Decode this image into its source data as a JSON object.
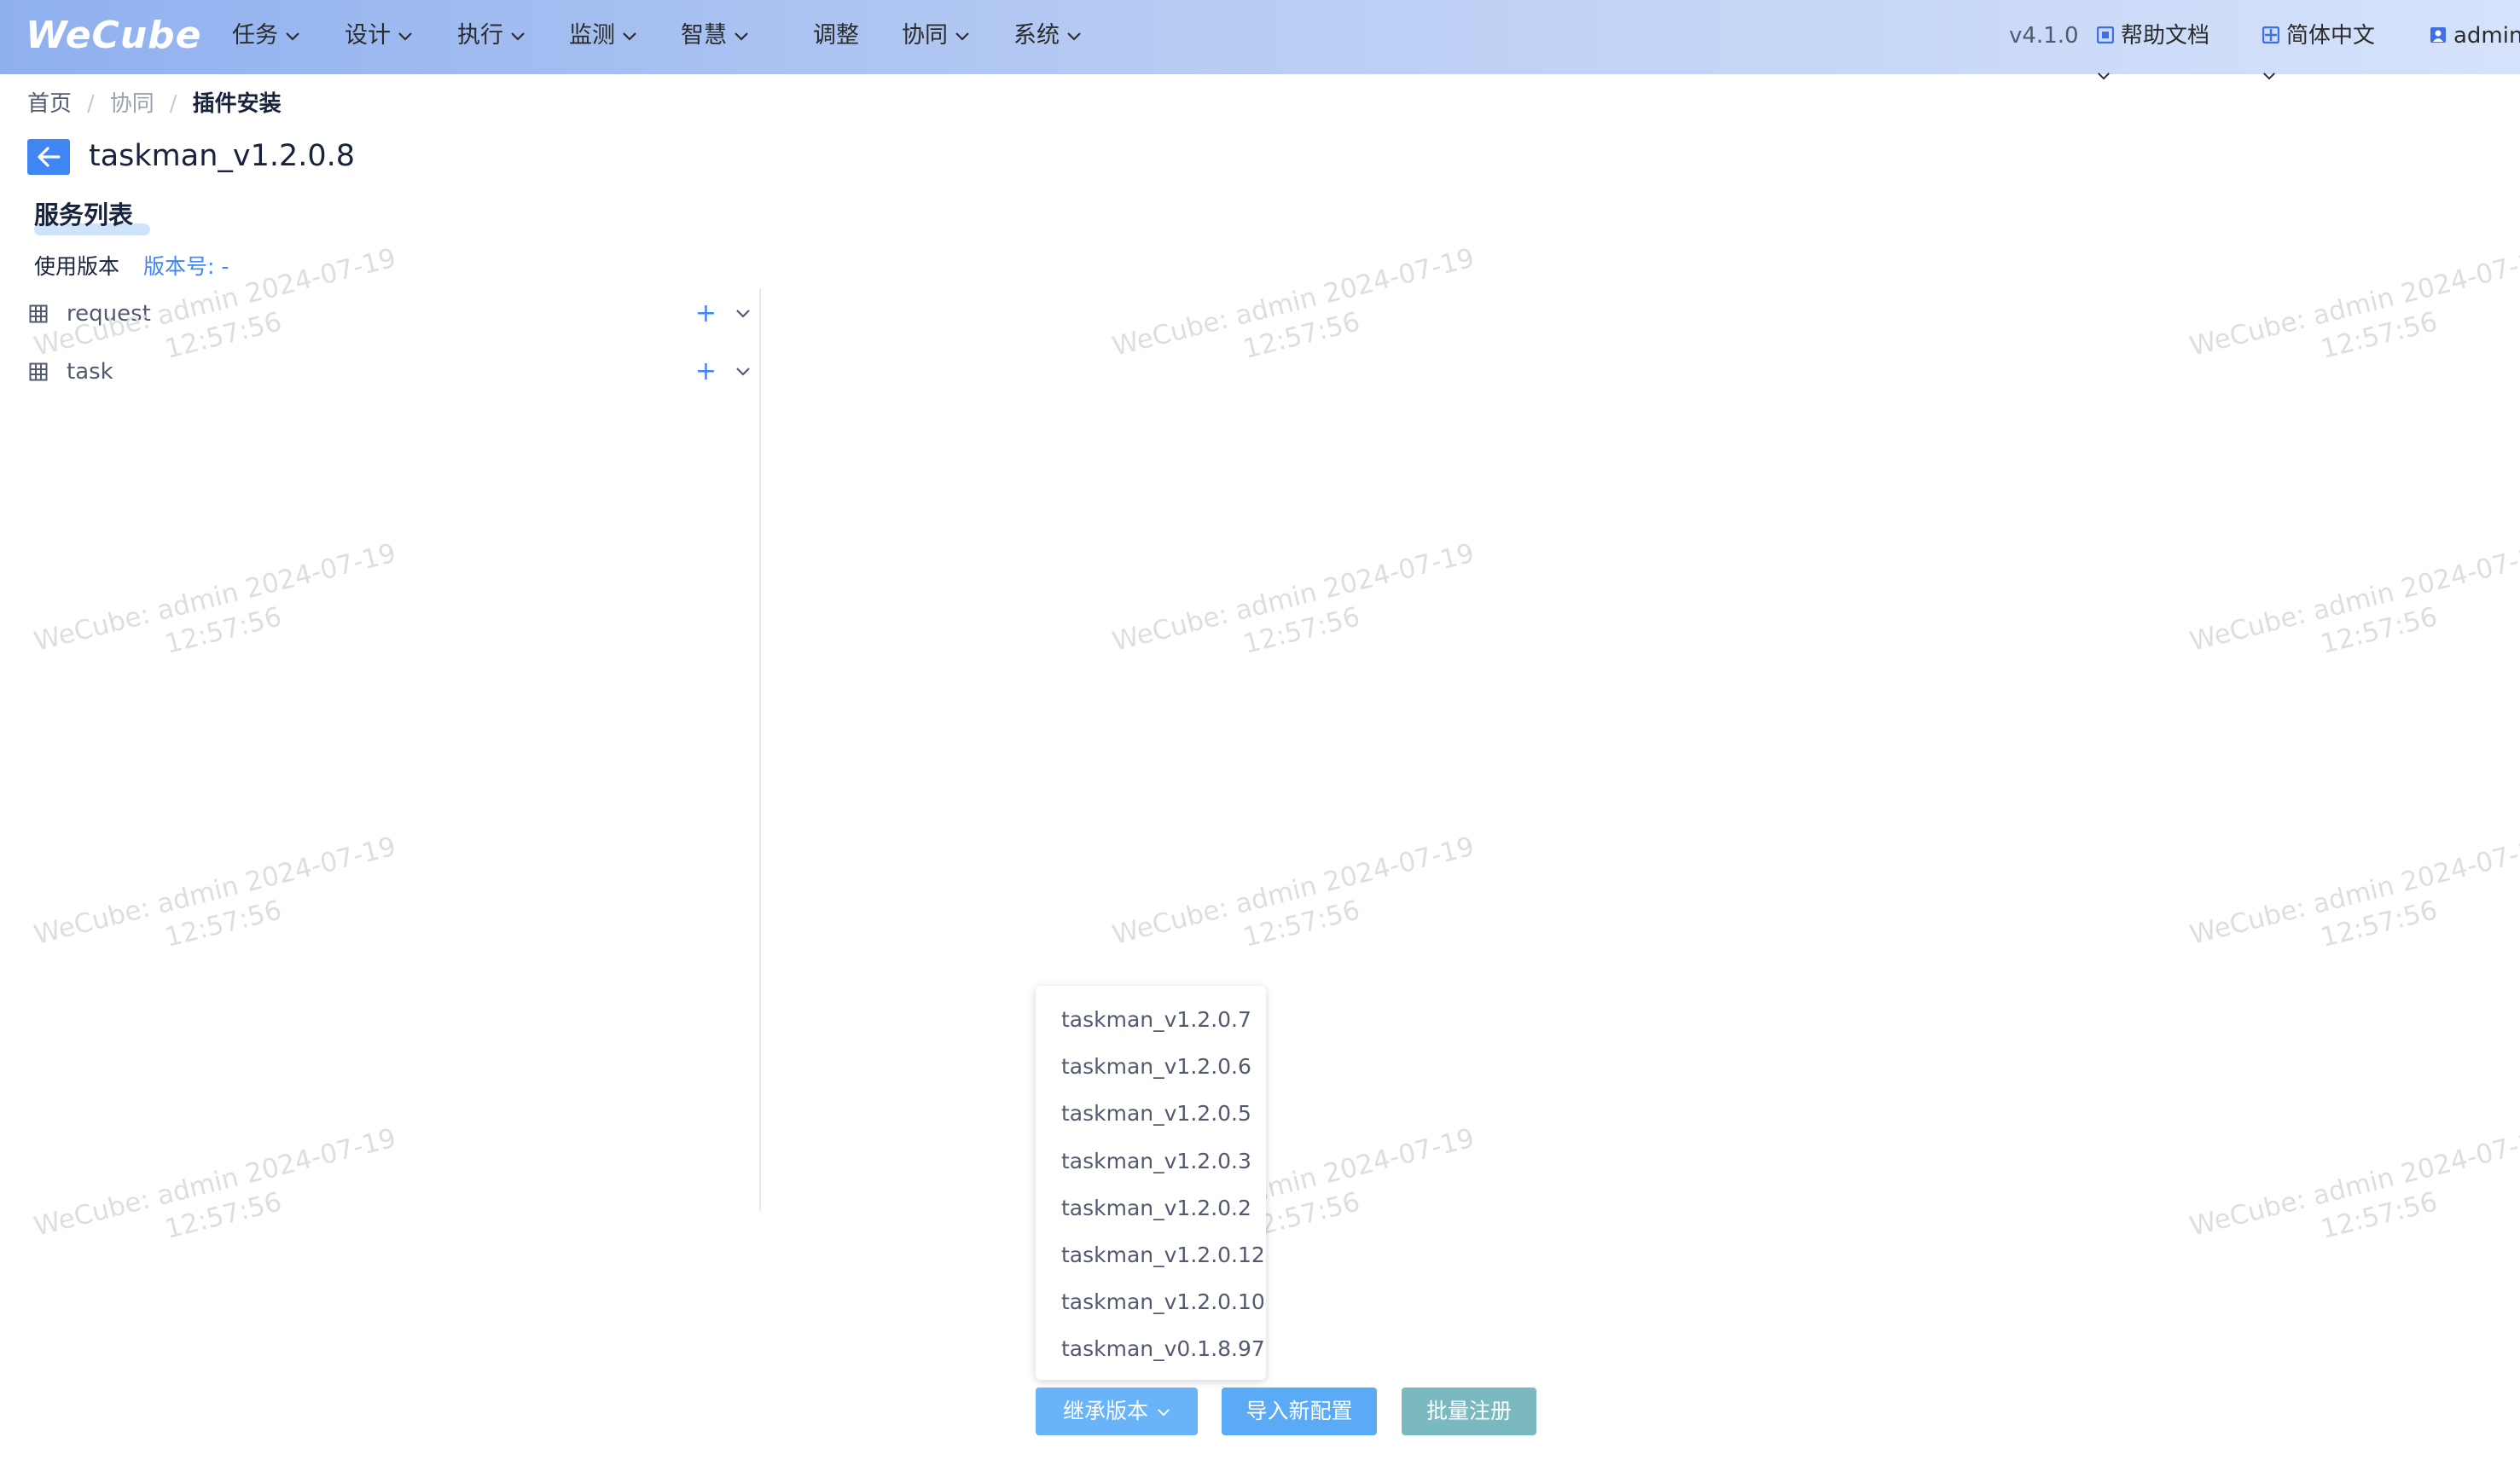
{
  "header": {
    "logo": "WeCube",
    "nav": [
      {
        "label": "任务",
        "has_dropdown": true
      },
      {
        "label": "设计",
        "has_dropdown": true
      },
      {
        "label": "执行",
        "has_dropdown": true
      },
      {
        "label": "监测",
        "has_dropdown": true
      },
      {
        "label": "智慧",
        "has_dropdown": true
      },
      {
        "label": "调整",
        "has_dropdown": false
      },
      {
        "label": "协同",
        "has_dropdown": true
      },
      {
        "label": "系统",
        "has_dropdown": true
      }
    ],
    "version": "v4.1.0",
    "help_docs": "帮助文档",
    "language": "简体中文",
    "user": "admin"
  },
  "breadcrumb": [
    "首页",
    "协同",
    "插件安装"
  ],
  "page_title": "taskman_v1.2.0.8",
  "service_list": {
    "title": "服务列表",
    "version_label": "使用版本",
    "version_value": "版本号: -",
    "items": [
      "request",
      "task"
    ]
  },
  "watermark": {
    "line1": "WeCube: admin 2024-07-19",
    "line2": "12:57:56"
  },
  "dropdown_options": [
    "taskman_v1.2.0.7",
    "taskman_v1.2.0.6",
    "taskman_v1.2.0.5",
    "taskman_v1.2.0.3",
    "taskman_v1.2.0.2",
    "taskman_v1.2.0.12",
    "taskman_v1.2.0.10",
    "taskman_v0.1.8.97"
  ],
  "buttons": {
    "inherit": "继承版本",
    "import": "导入新配置",
    "batch_register": "批量注册"
  },
  "colors": {
    "primary": "#3f86f2",
    "batch_button": "#79b9bf"
  }
}
